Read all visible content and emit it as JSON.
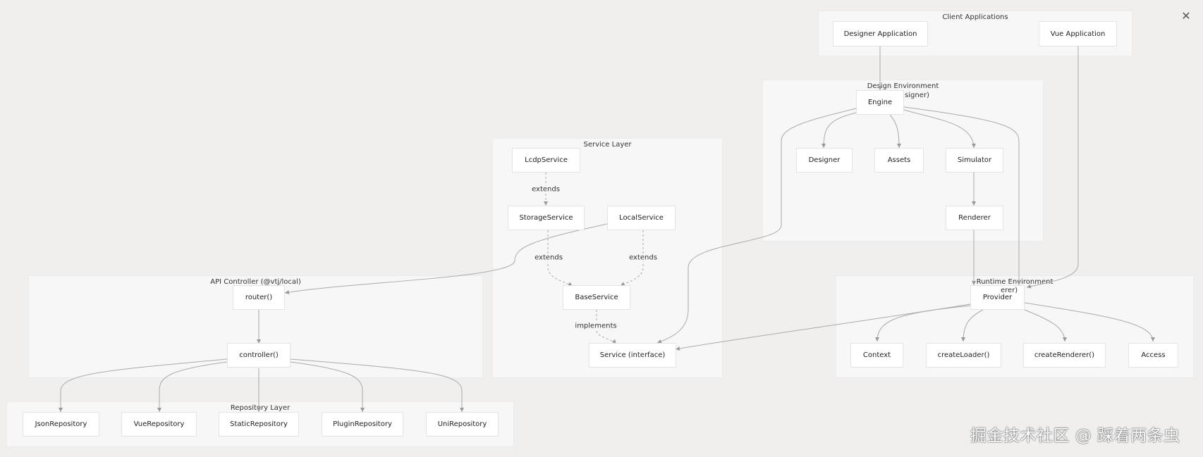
{
  "clusters": {
    "client": "Client Applications",
    "design": "Design Environment",
    "design_suffix": "signer)",
    "service": "Service Layer",
    "api": "API Controller (@vtj/local)",
    "runtime": "Runtime Environment",
    "runtime_suffix": "erer)",
    "repository": "Repository Layer"
  },
  "nodes": {
    "designer_app": "Designer Application",
    "vue_app": "Vue Application",
    "engine": "Engine",
    "designer": "Designer",
    "assets": "Assets",
    "simulator": "Simulator",
    "renderer": "Renderer",
    "lcdp_service": "LcdpService",
    "storage_service": "StorageService",
    "local_service": "LocalService",
    "base_service": "BaseService",
    "service_interface": "Service (interface)",
    "router": "router()",
    "controller": "controller()",
    "provider": "Provider",
    "context": "Context",
    "create_loader": "createLoader()",
    "create_renderer": "createRenderer()",
    "access": "Access",
    "json_repo": "JsonRepository",
    "vue_repo": "VueRepository",
    "static_repo": "StaticRepository",
    "plugin_repo": "PluginRepository",
    "uni_repo": "UniRepository"
  },
  "edge_labels": {
    "lcdp_storage": "extends",
    "storage_base": "extends",
    "local_base": "extends",
    "base_service": "implements"
  },
  "close_icon": "✕",
  "watermark": "掘金技术社区 @ 踩着两条虫"
}
